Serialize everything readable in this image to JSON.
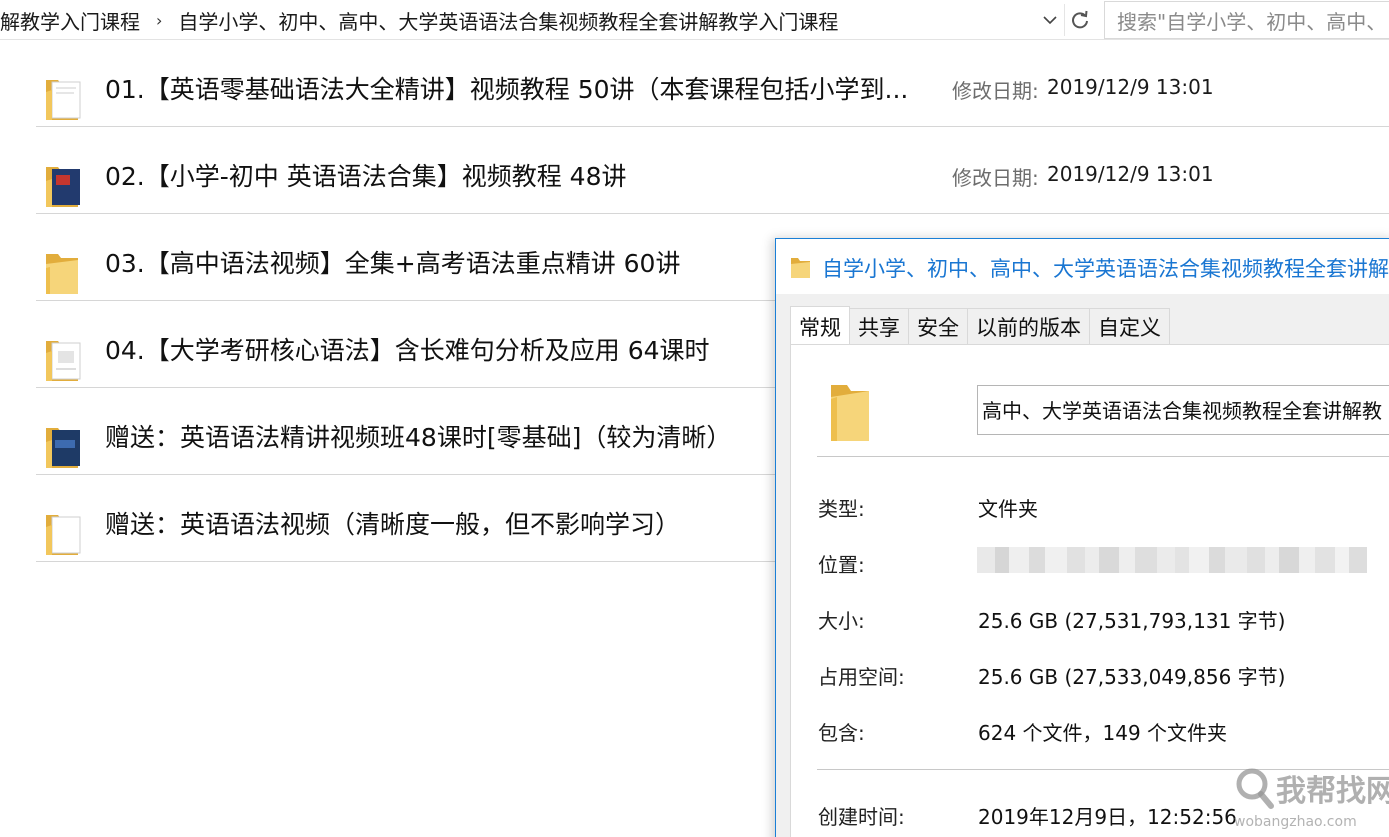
{
  "address_bar": {
    "breadcrumb_parent": "解教学入门课程",
    "breadcrumb_current": "自学小学、初中、高中、大学英语语法合集视频教程全套讲解教学入门课程",
    "search_placeholder": "搜索\"自学小学、初中、高中、"
  },
  "files": [
    {
      "name": "01.【英语零基础语法大全精讲】视频教程 50讲（本套课程包括小学到...",
      "date_label": "修改日期:",
      "date": "2019/12/9 13:01",
      "icon": "folder-with-documents-icon"
    },
    {
      "name": "02.【小学-初中 英语语法合集】视频教程 48讲",
      "date_label": "修改日期:",
      "date": "2019/12/9 13:01",
      "icon": "folder-with-book-cover-icon"
    },
    {
      "name": "03.【高中语法视频】全集+高考语法重点精讲 60讲",
      "icon": "folder-icon"
    },
    {
      "name": "04.【大学考研核心语法】含长难句分析及应用 64课时",
      "icon": "folder-with-documents-icon"
    },
    {
      "name": "赠送：英语语法精讲视频班48课时[零基础]（较为清晰）",
      "icon": "folder-with-book-cover-icon"
    },
    {
      "name": "赠送：英语语法视频（清晰度一般，但不影响学习）",
      "icon": "folder-with-documents-icon"
    }
  ],
  "dialog": {
    "title": "自学小学、初中、高中、大学英语语法合集视频教程全套讲解",
    "tabs": [
      "常规",
      "共享",
      "安全",
      "以前的版本",
      "自定义"
    ],
    "active_tab": "常规",
    "folder_name": "高中、大学英语语法合集视频教程全套讲解教",
    "props": {
      "type_label": "类型:",
      "type_value": "文件夹",
      "location_label": "位置:",
      "size_label": "大小:",
      "size_value": "25.6 GB (27,531,793,131 字节)",
      "disk_label": "占用空间:",
      "disk_value": "25.6 GB (27,533,049,856 字节)",
      "contains_label": "包含:",
      "contains_value": "624 个文件，149 个文件夹",
      "created_label": "创建时间:",
      "created_value": "2019年12月9日，12:52:56"
    }
  },
  "watermark": {
    "text": "我帮找网",
    "url": "wobangzhao.com"
  },
  "colors": {
    "accent": "#1976d2",
    "folder_yellow": "#f2c75c",
    "divider": "#d6d6d6"
  }
}
